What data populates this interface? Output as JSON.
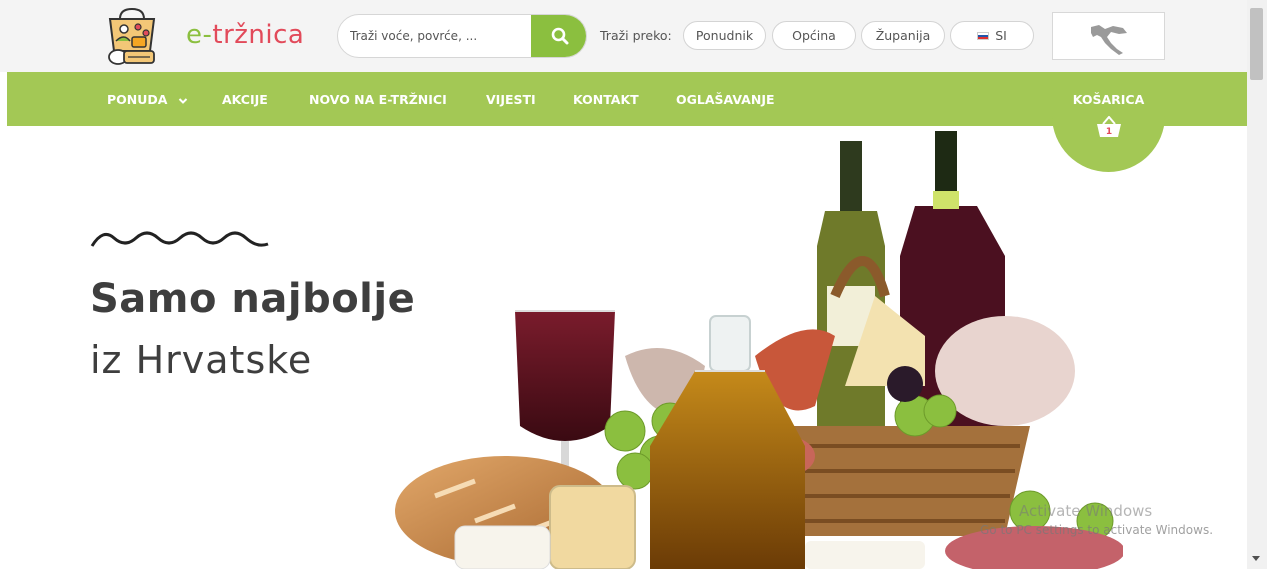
{
  "brand": {
    "prefix": "e-",
    "name": "tržnica",
    "color_green": "#8bbf3f",
    "color_red": "#e24a5a",
    "logo_icon": "basket-logo-icon"
  },
  "search": {
    "placeholder": "Traži voće, povrće, ...",
    "button_icon": "search-icon"
  },
  "filter": {
    "label": "Traži preko:",
    "options": [
      "Ponudnik",
      "Općina",
      "Županija"
    ],
    "language": "SI",
    "language_icon": "slovenia-flag-icon"
  },
  "map_icon": "croatia-map-icon",
  "nav": {
    "items": [
      "PONUDA",
      "AKCIJE",
      "NOVO NA E-TRŽNICI",
      "VIJESTI",
      "KONTAKT",
      "OGLAŠAVANJE"
    ],
    "dropdown_icon": "chevron-down-icon",
    "background": "#a3c855"
  },
  "cart": {
    "label": "KOŠARICA",
    "count": "1",
    "icon": "basket-icon"
  },
  "hero": {
    "title": "Samo najbolje",
    "subtitle": "iz Hrvatske",
    "decoration_icon": "wave-icon",
    "image": "wine-and-food-basket-image"
  },
  "watermark": {
    "line1": "Activate Windows",
    "line2": "Go to PC settings to activate Windows."
  }
}
